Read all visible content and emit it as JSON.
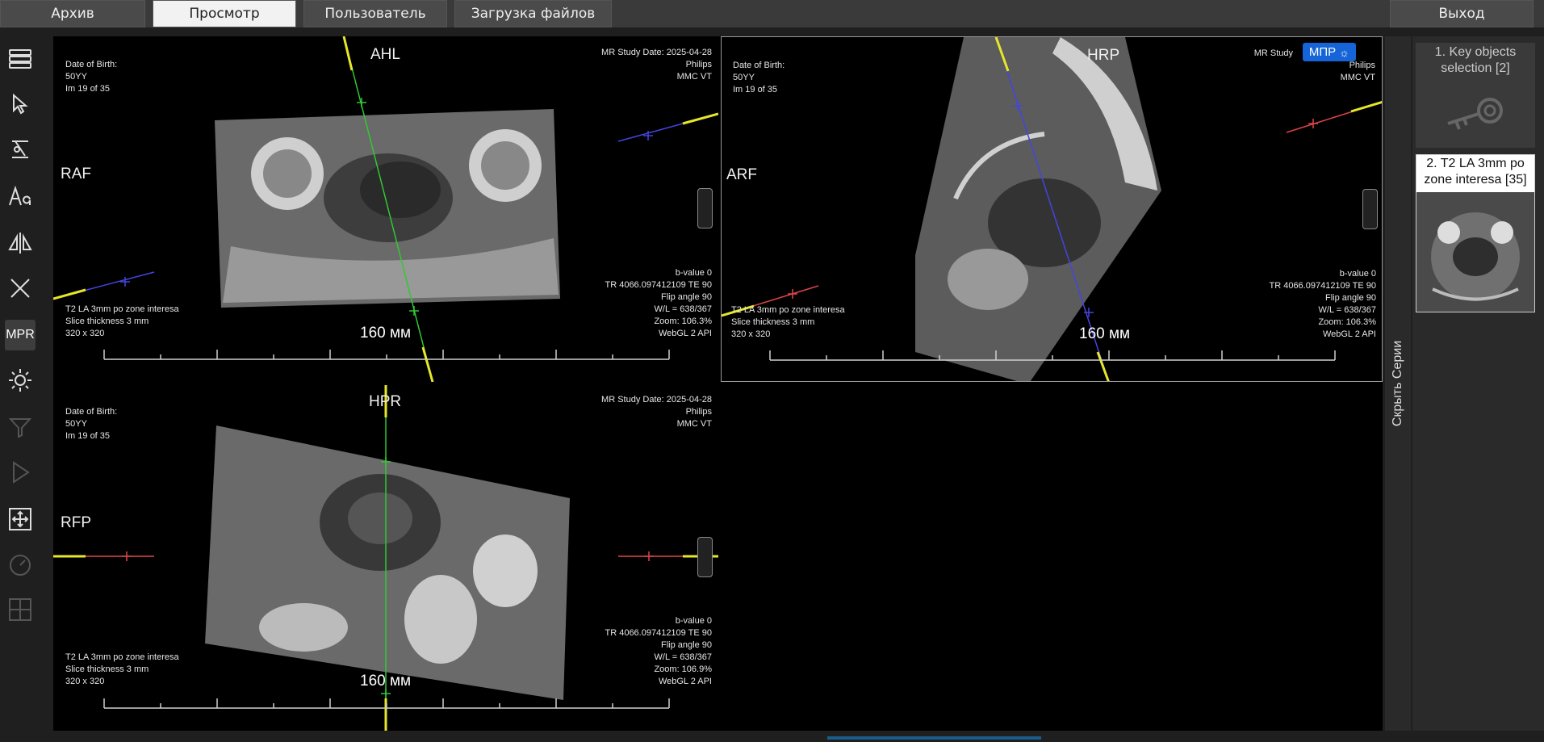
{
  "top_nav": {
    "tabs": [
      {
        "label": "Архив",
        "active": false
      },
      {
        "label": "Просмотр",
        "active": true
      },
      {
        "label": "Пользователь",
        "active": false
      },
      {
        "label": "Загрузка файлов",
        "active": false
      }
    ],
    "exit_label": "Выход"
  },
  "toolbar": {
    "tools": [
      "layout-icon",
      "pointer-icon",
      "measure-icon",
      "text-annotation-icon",
      "flip-icon",
      "close-icon",
      "mpr",
      "window-level-icon",
      "filter-icon",
      "play-icon",
      "fit-icon",
      "speed-icon",
      "grid-icon"
    ],
    "mpr_label": "MPR"
  },
  "viewports": [
    {
      "dob_label": "Date of Birth:",
      "age": "50YY",
      "image_index": "Im 19 of 35",
      "study_date": "MR Study Date: 2025-04-28",
      "manufacturer": "Philips",
      "institution": "MMC VT",
      "top_orient": "AHL",
      "left_orient": "RAF",
      "series_desc": "T2 LA 3mm po zone interesa",
      "slice_thickness": "Slice thickness 3 mm",
      "matrix": "320 x 320",
      "b_value": "b-value 0",
      "tr_te": "TR 4066.097412109 TE 90",
      "flip": "Flip angle 90",
      "wl": "W/L = 638/367",
      "zoom": "Zoom: 106.3%",
      "api": "WebGL 2 API",
      "scale_label": "160 мм"
    },
    {
      "dob_label": "Date of Birth:",
      "age": "50YY",
      "image_index": "Im 19 of 35",
      "study_date": "MR Study",
      "manufacturer": "Philips",
      "institution": "MMC VT",
      "top_orient": "HRP",
      "left_orient": "ARF",
      "series_desc": "T2 LA 3mm po zone interesa",
      "slice_thickness": "Slice thickness 3 mm",
      "matrix": "320 x 320",
      "b_value": "b-value 0",
      "tr_te": "TR 4066.097412109 TE 90",
      "flip": "Flip angle 90",
      "wl": "W/L = 638/367",
      "zoom": "Zoom: 106.3%",
      "api": "WebGL 2 API",
      "scale_label": "160 мм",
      "badge": "МПР"
    },
    {
      "dob_label": "Date of Birth:",
      "age": "50YY",
      "image_index": "Im 19 of 35",
      "study_date": "MR Study Date: 2025-04-28",
      "manufacturer": "Philips",
      "institution": "MMC VT",
      "top_orient": "HPR",
      "left_orient": "RFP",
      "series_desc": "T2 LA 3mm po zone interesa",
      "slice_thickness": "Slice thickness 3 mm",
      "matrix": "320 x 320",
      "b_value": "b-value 0",
      "tr_te": "TR 4066.097412109 TE 90",
      "flip": "Flip angle 90",
      "wl": "W/L = 638/367",
      "zoom": "Zoom: 106.9%",
      "api": "WebGL 2 API",
      "scale_label": "160 мм"
    }
  ],
  "series_panel": {
    "hide_label": "Скрыть Серии",
    "items": [
      {
        "label": "1. Key objects selection [2]"
      },
      {
        "label": "2. T2 LA 3mm po zone interesa [35]"
      }
    ]
  }
}
